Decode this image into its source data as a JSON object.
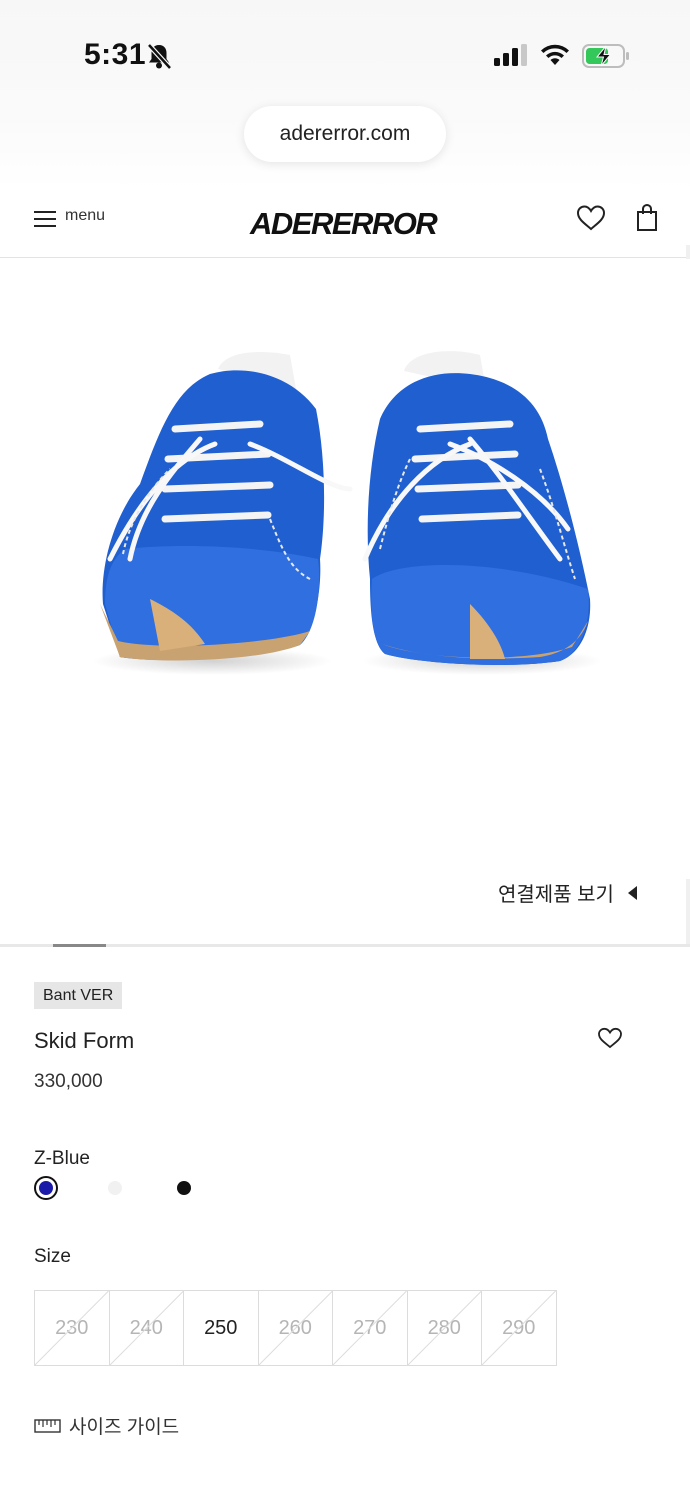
{
  "status_bar": {
    "time": "5:31",
    "icons": [
      "bell-slash-icon",
      "signal-icon",
      "wifi-icon",
      "battery-charging-icon"
    ],
    "battery_color": "#34c759"
  },
  "browser": {
    "url": "adererror.com"
  },
  "header": {
    "menu_label": "menu",
    "logo": "ADERERROR",
    "icons": [
      "menu-icon",
      "heart-icon",
      "shopping-bag-icon"
    ]
  },
  "product_image": {
    "subject": "blue suede sneakers"
  },
  "related_link": "연결제품 보기",
  "carousel": {
    "current_index": 1,
    "total": 13
  },
  "product": {
    "badge": "Bant VER",
    "name": "Skid Form",
    "price": "330,000"
  },
  "color": {
    "selected_label": "Z-Blue",
    "swatches": [
      {
        "hex": "#1a1aa8",
        "selected": true
      },
      {
        "hex": "#f1f1f1",
        "selected": false
      },
      {
        "hex": "#111111",
        "selected": false
      }
    ]
  },
  "size": {
    "label": "Size",
    "options": [
      {
        "value": "230",
        "available": false
      },
      {
        "value": "240",
        "available": false
      },
      {
        "value": "250",
        "available": true
      },
      {
        "value": "260",
        "available": false
      },
      {
        "value": "270",
        "available": false
      },
      {
        "value": "280",
        "available": false
      },
      {
        "value": "290",
        "available": false
      }
    ]
  },
  "size_guide": {
    "label": "사이즈 가이드",
    "icon": "ruler-icon"
  }
}
